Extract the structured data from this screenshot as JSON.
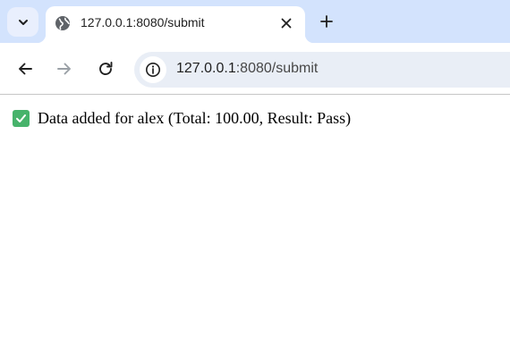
{
  "browser": {
    "tab": {
      "title": "127.0.0.1:8080/submit",
      "favicon": "globe-icon",
      "close_icon": "close-icon"
    },
    "tab_search_icon": "chevron-down-icon",
    "new_tab_icon": "plus-icon",
    "nav": {
      "back_icon": "arrow-left-icon",
      "forward_icon": "arrow-right-icon",
      "reload_icon": "reload-icon"
    },
    "address_bar": {
      "host": "127.0.0.1",
      "path": ":8080/submit",
      "site_info_icon": "info-icon"
    },
    "colors": {
      "tabstrip": "#d3e3fd",
      "omnibox": "#e9eef6",
      "check": "#47b36b"
    }
  },
  "page": {
    "status_icon": "check-mark-icon",
    "message": "Data added for alex (Total: 100.00, Result: Pass)"
  }
}
